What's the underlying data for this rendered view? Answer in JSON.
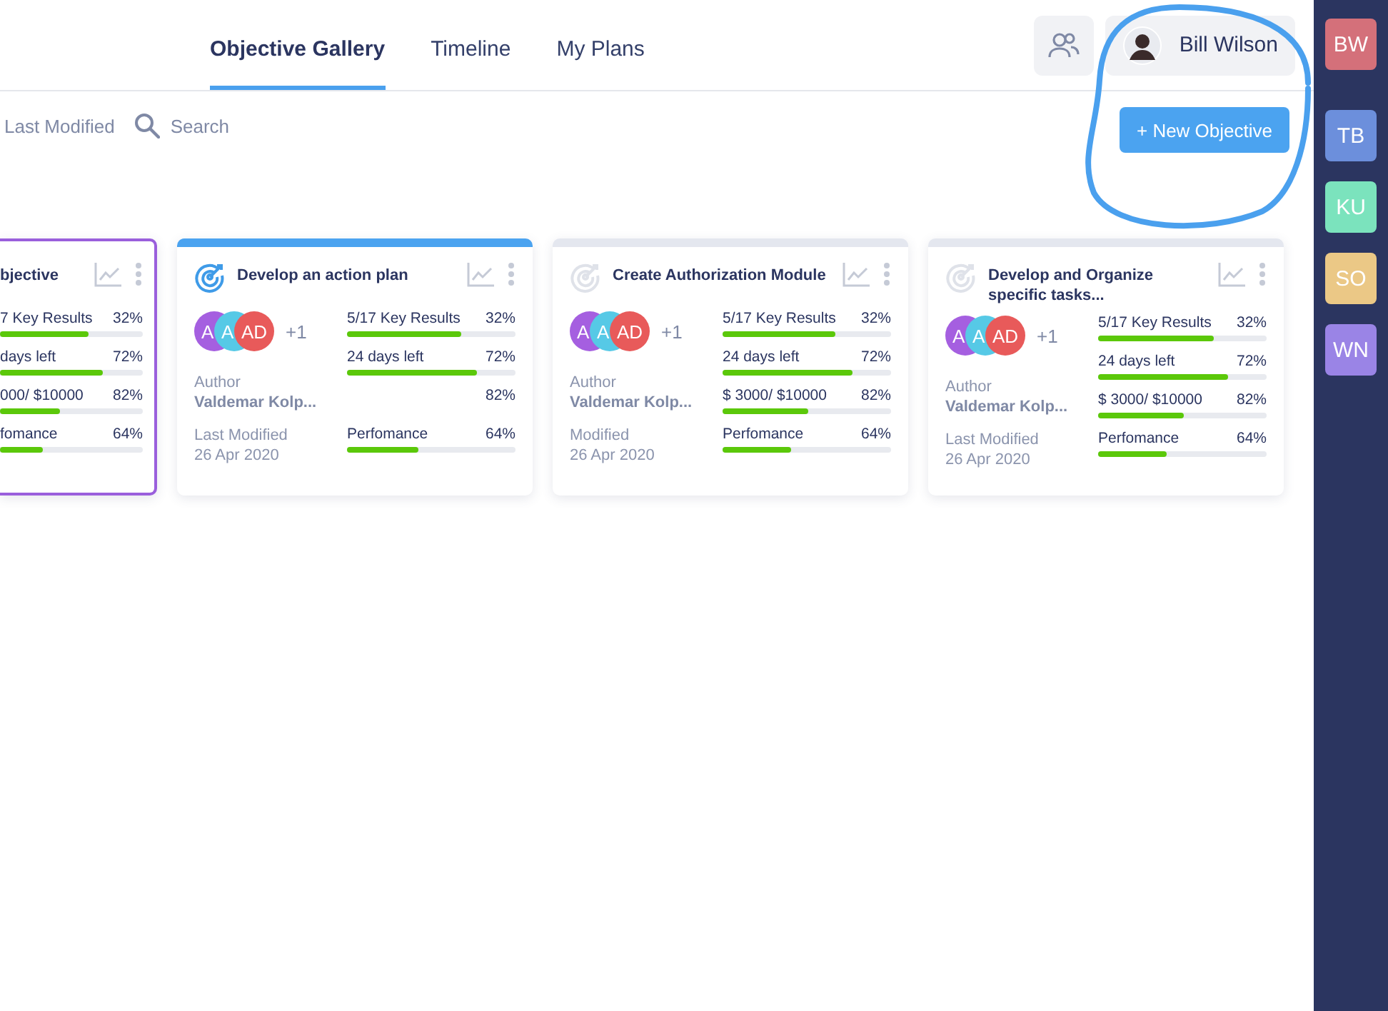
{
  "tabs": [
    {
      "label": "Objective Gallery",
      "selected": true
    },
    {
      "label": "Timeline",
      "selected": false
    },
    {
      "label": "My Plans",
      "selected": false
    }
  ],
  "header": {
    "user_name": "Bill Wilson"
  },
  "toolbar": {
    "sort_label": "Last Modified",
    "search_placeholder": "Search",
    "new_button": "+ New Objective"
  },
  "cards": [
    {
      "kind": "partial",
      "selected": true,
      "title": "bjective",
      "metrics": [
        {
          "label": "7 Key Results",
          "value": "32%",
          "level": 0.62
        },
        {
          "label": "days left",
          "value": "72%",
          "level": 0.72
        },
        {
          "label": "000/ $10000",
          "value": "82%",
          "level": 0.42
        },
        {
          "label": "fomance",
          "value": "64%",
          "level": 0.3
        }
      ]
    },
    {
      "kind": "full",
      "selected": false,
      "color": "#4ba3f0",
      "icon_active": true,
      "title": "Develop an action plan",
      "avatars": [
        {
          "initials": "A",
          "color": "#a55fe0"
        },
        {
          "initials": "A",
          "color": "#56c9e6"
        },
        {
          "initials": "AD",
          "color": "#e85a5a"
        }
      ],
      "avatar_more": "+1",
      "author_label": "Author",
      "author": "Valdemar Kolp...",
      "modified_label": "Last Modified",
      "modified": "26 Apr 2020",
      "metrics": [
        {
          "label": "5/17 Key Results",
          "value": "32%",
          "level": 0.68
        },
        {
          "label": "24 days left",
          "value": "72%",
          "level": 0.77
        },
        {
          "value": "82%"
        },
        {
          "label": "Perfomance",
          "value": "64%",
          "level": 0.42
        }
      ]
    },
    {
      "kind": "full",
      "selected": false,
      "color": "#e4e7ef",
      "icon_active": false,
      "title": "Create Authorization Module",
      "avatars": [
        {
          "initials": "A",
          "color": "#a55fe0"
        },
        {
          "initials": "A",
          "color": "#56c9e6"
        },
        {
          "initials": "AD",
          "color": "#e85a5a"
        }
      ],
      "avatar_more": "+1",
      "author_label": "Author",
      "author": "Valdemar Kolp...",
      "modified_label": "Modified",
      "modified": "26 Apr 2020",
      "metrics": [
        {
          "label": "5/17 Key Results",
          "value": "32%",
          "level": 0.67
        },
        {
          "label": "24 days left",
          "value": "72%",
          "level": 0.77
        },
        {
          "label": "$ 3000/ $10000",
          "value": "82%",
          "level": 0.51
        },
        {
          "label": "Perfomance",
          "value": "64%",
          "level": 0.41
        }
      ]
    },
    {
      "kind": "full",
      "selected": false,
      "color": "#e4e7ef",
      "icon_active": false,
      "title": "Develop and Organize specific tasks...",
      "avatars": [
        {
          "initials": "A",
          "color": "#a55fe0"
        },
        {
          "initials": "A",
          "color": "#56c9e6"
        },
        {
          "initials": "AD",
          "color": "#e85a5a"
        }
      ],
      "avatar_more": "+1",
      "author_label": "Author",
      "author": "Valdemar Kolp...",
      "modified_label": "Last Modified",
      "modified": "26 Apr 2020",
      "metrics": [
        {
          "label": "5/17 Key Results",
          "value": "32%",
          "level": 0.69
        },
        {
          "label": "24 days left",
          "value": "72%",
          "level": 0.77
        },
        {
          "label": "$ 3000/ $10000",
          "value": "82%",
          "level": 0.51
        },
        {
          "label": "Perfomance",
          "value": "64%",
          "level": 0.41
        }
      ]
    }
  ],
  "sidebar": {
    "items": [
      {
        "initials": "BW",
        "color": "#d4707a"
      },
      {
        "initials": "TB",
        "color": "#6c8fdc"
      },
      {
        "initials": "KU",
        "color": "#7be3bd"
      },
      {
        "initials": "SO",
        "color": "#ebc886"
      },
      {
        "initials": "WN",
        "color": "#9a84e6"
      }
    ]
  }
}
